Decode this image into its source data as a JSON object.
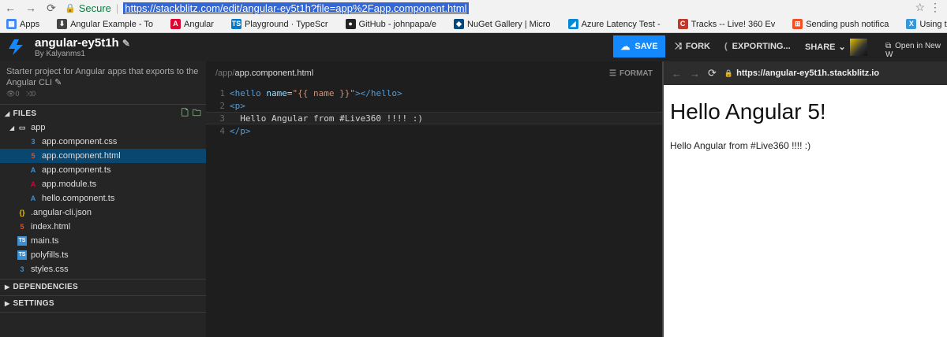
{
  "browser": {
    "secure_label": "Secure",
    "url": "https://stackblitz.com/edit/angular-ey5t1h?file=app%2Fapp.component.html",
    "bookmarks": [
      {
        "label": "Apps",
        "color": "#4285f4"
      },
      {
        "label": "Angular Example - To",
        "color": "#444"
      },
      {
        "label": "Angular",
        "color": "#dd0031"
      },
      {
        "label": "Playground · TypeScr",
        "color": "#007acc"
      },
      {
        "label": "GitHub - johnpapa/e",
        "color": "#222"
      },
      {
        "label": "NuGet Gallery | Micro",
        "color": "#004880"
      },
      {
        "label": "Azure Latency Test - ",
        "color": "#0089d6"
      },
      {
        "label": "Tracks -- Live! 360 Ev",
        "color": "#c0392b"
      },
      {
        "label": "Sending push notifica",
        "color": "#f25022"
      },
      {
        "label": "Using the Xamarin Ar",
        "color": "#3498db"
      }
    ]
  },
  "header": {
    "project_name": "angular-ey5t1h",
    "author": "By Kalyanms1",
    "save_label": "SAVE",
    "fork_label": "FORK",
    "exporting_label": "EXPORTING...",
    "share_label": "SHARE",
    "open_new_label": "Open in New W"
  },
  "sidebar": {
    "description": "Starter project for Angular apps that exports to the Angular CLI",
    "views": "0",
    "forks": "0",
    "files_label": "FILES",
    "dependencies_label": "DEPENDENCIES",
    "settings_label": "SETTINGS",
    "files": [
      {
        "label": "app",
        "kind": "folder",
        "indent": 0
      },
      {
        "label": "app.component.css",
        "kind": "css",
        "indent": 1
      },
      {
        "label": "app.component.html",
        "kind": "html",
        "indent": 1,
        "active": true
      },
      {
        "label": "app.component.ts",
        "kind": "ng",
        "indent": 1
      },
      {
        "label": "app.module.ts",
        "kind": "ngmod",
        "indent": 1
      },
      {
        "label": "hello.component.ts",
        "kind": "ng",
        "indent": 1
      },
      {
        "label": ".angular-cli.json",
        "kind": "json",
        "indent": 0
      },
      {
        "label": "index.html",
        "kind": "html",
        "indent": 0
      },
      {
        "label": "main.ts",
        "kind": "ts",
        "indent": 0
      },
      {
        "label": "polyfills.ts",
        "kind": "ts",
        "indent": 0
      },
      {
        "label": "styles.css",
        "kind": "css",
        "indent": 0
      }
    ]
  },
  "editor": {
    "path_dim": "/app/",
    "path_file": "app.component.html",
    "format_label": "FORMAT",
    "lines": [
      {
        "num": "1"
      },
      {
        "num": "2"
      },
      {
        "num": "3",
        "text": "  Hello Angular from #Live360 !!!! :)"
      },
      {
        "num": "4"
      }
    ]
  },
  "preview": {
    "url": "https://angular-ey5t1h.stackblitz.io",
    "heading": "Hello Angular 5!",
    "paragraph": "Hello Angular from #Live360 !!!! :)"
  },
  "colors": {
    "accent": "#1389fd",
    "active_file": "#094771"
  }
}
